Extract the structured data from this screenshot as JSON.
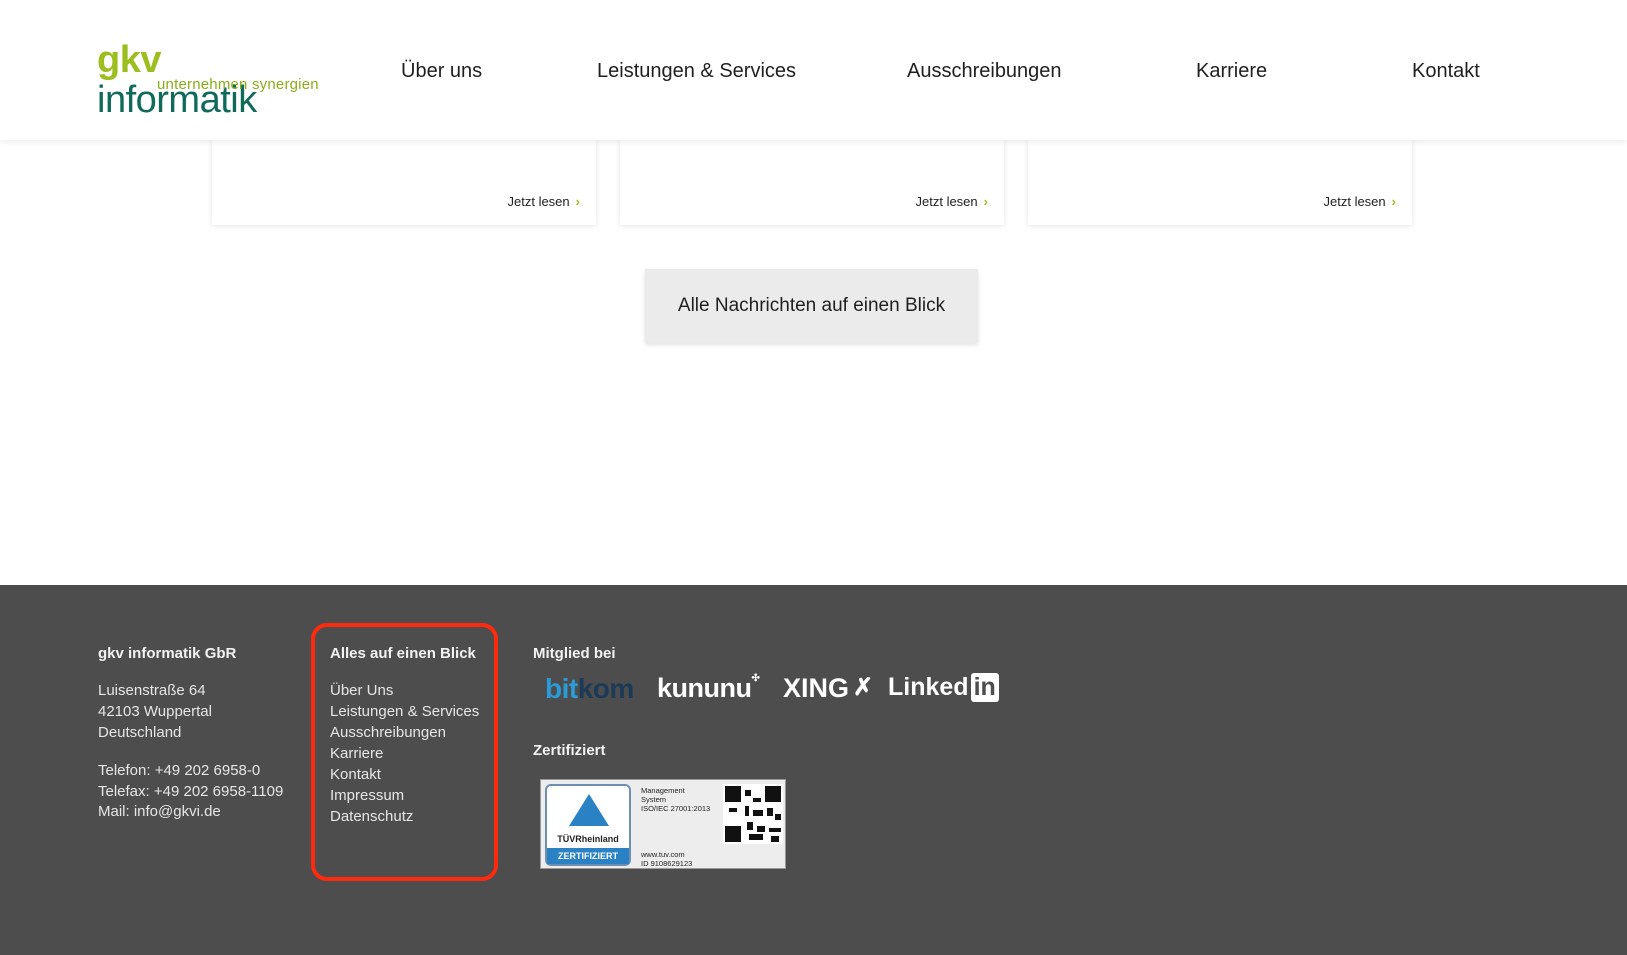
{
  "header": {
    "logo": {
      "brand_short": "gkv",
      "brand_name": "informatik",
      "tagline": "unternehmen synergien"
    },
    "nav": [
      "Über uns",
      "Leistungen & Services",
      "Ausschreibungen",
      "Karriere",
      "Kontakt"
    ]
  },
  "cards": [
    {
      "read_more": "Jetzt lesen"
    },
    {
      "read_more": "Jetzt lesen"
    },
    {
      "read_more": "Jetzt lesen"
    }
  ],
  "chevron_icon": "›",
  "all_news_button": "Alle Nachrichten auf einen Blick",
  "footer": {
    "company": {
      "title": "gkv informatik GbR",
      "address": [
        "Luisenstraße 64",
        "42103 Wuppertal",
        "Deutschland"
      ],
      "contact": [
        "Telefon: +49 202 6958-0",
        "Telefax: +49 202 6958-1109",
        "Mail: info@gkvi.de"
      ]
    },
    "links": {
      "title": "Alles auf einen Blick",
      "items": [
        "Über Uns",
        "Leistungen & Services",
        "Ausschreibungen",
        "Karriere",
        "Kontakt",
        "Impressum",
        "Datenschutz"
      ]
    },
    "member": {
      "title": "Mitglied bei",
      "logos": {
        "bitkom_a": "bit",
        "bitkom_b": "kom",
        "kununu": "kununu",
        "xing": "XING",
        "linkedin_a": "Linked",
        "linkedin_b": "in"
      }
    },
    "certified": {
      "title": "Zertifiziert",
      "badge_name": "TÜVRheinland",
      "badge_label": "ZERTIFIZIERT",
      "lines": [
        "Management",
        "System",
        "ISO/IEC 27001:2013"
      ],
      "url": "www.tuv.com",
      "id": "ID 9108629123"
    }
  },
  "colors": {
    "brand_green": "#9cbe1e",
    "brand_teal": "#0f6a5a",
    "footer_bg": "#4d4d4d",
    "highlight": "#ff2a0e"
  }
}
